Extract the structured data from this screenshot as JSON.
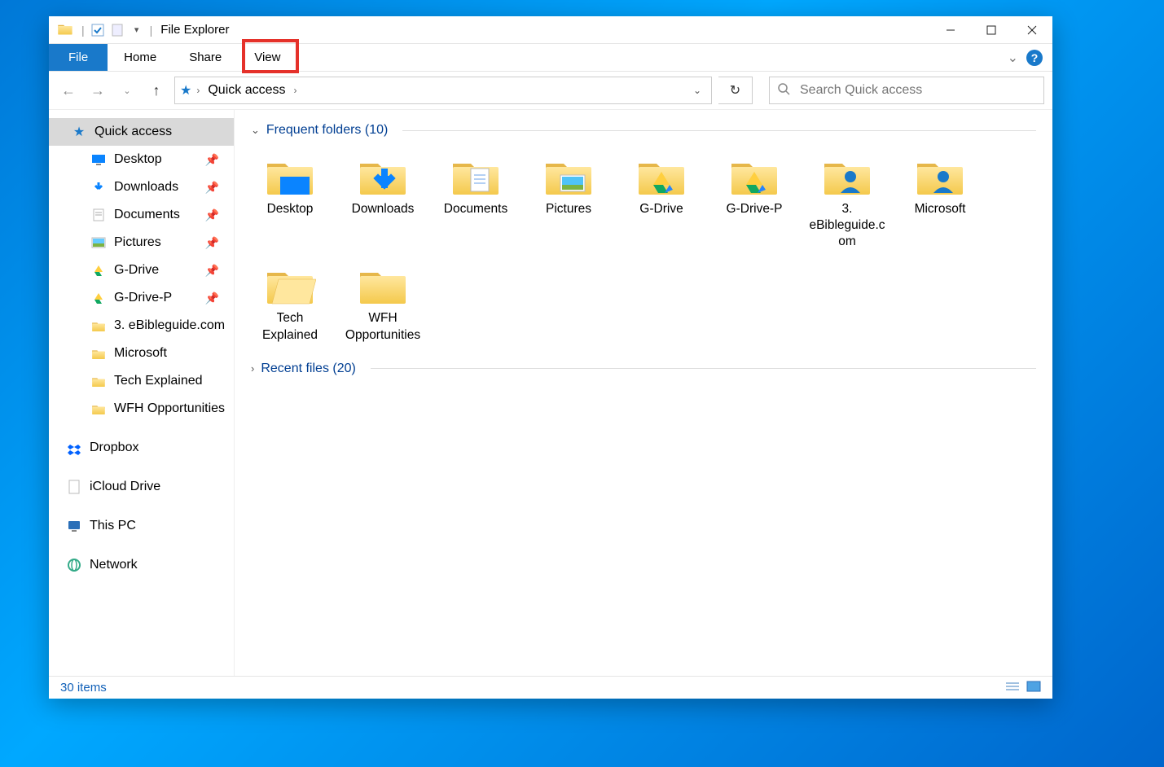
{
  "window": {
    "title": "File Explorer"
  },
  "ribbon": {
    "file": "File",
    "home": "Home",
    "share": "Share",
    "view": "View"
  },
  "address": {
    "location": "Quick access"
  },
  "search": {
    "placeholder": "Search Quick access"
  },
  "tree": {
    "quick_access": "Quick access",
    "items": [
      {
        "label": "Desktop",
        "pin": true,
        "icon": "desktop"
      },
      {
        "label": "Downloads",
        "pin": true,
        "icon": "download"
      },
      {
        "label": "Documents",
        "pin": true,
        "icon": "document"
      },
      {
        "label": "Pictures",
        "pin": true,
        "icon": "pictures"
      },
      {
        "label": "G-Drive",
        "pin": true,
        "icon": "gdrive"
      },
      {
        "label": "G-Drive-P",
        "pin": true,
        "icon": "gdrive"
      },
      {
        "label": "3. eBibleguide.com",
        "pin": false,
        "icon": "folder"
      },
      {
        "label": "Microsoft",
        "pin": false,
        "icon": "folder"
      },
      {
        "label": "Tech Explained",
        "pin": false,
        "icon": "folder"
      },
      {
        "label": "WFH Opportunities",
        "pin": false,
        "icon": "folder"
      }
    ],
    "dropbox": "Dropbox",
    "icloud": "iCloud Drive",
    "thispc": "This PC",
    "network": "Network"
  },
  "sections": {
    "frequent": {
      "title": "Frequent folders (10)"
    },
    "recent": {
      "title": "Recent files (20)"
    }
  },
  "folders": [
    {
      "label": "Desktop",
      "icon": "desktop"
    },
    {
      "label": "Downloads",
      "icon": "download"
    },
    {
      "label": "Documents",
      "icon": "document"
    },
    {
      "label": "Pictures",
      "icon": "pictures"
    },
    {
      "label": "G-Drive",
      "icon": "gdrive"
    },
    {
      "label": "G-Drive-P",
      "icon": "gdrive"
    },
    {
      "label": "3. eBibleguide.com",
      "icon": "person"
    },
    {
      "label": "Microsoft",
      "icon": "person"
    },
    {
      "label": "Tech Explained",
      "icon": "folder-open"
    },
    {
      "label": "WFH Opportunities",
      "icon": "folder"
    }
  ],
  "status": {
    "text": "30 items"
  }
}
